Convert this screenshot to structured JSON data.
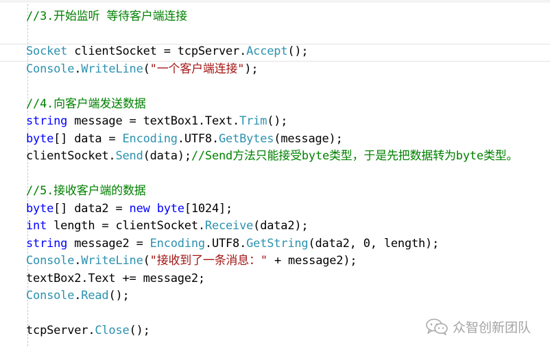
{
  "editor": {
    "language": "C#",
    "colors": {
      "comment": "#008000",
      "type": "#2b91af",
      "keyword": "#0000ff",
      "string": "#a31515",
      "plain": "#000000"
    },
    "lines": [
      {
        "tokens": [
          {
            "c": "comment",
            "t": "//3.开始监听 等待客户端连接"
          }
        ]
      },
      {
        "tokens": []
      },
      {
        "tokens": [
          {
            "c": "type",
            "t": "Socket"
          },
          {
            "c": "plain",
            "t": " clientSocket = tcpServer."
          },
          {
            "c": "type",
            "t": "Accept"
          },
          {
            "c": "plain",
            "t": "();"
          }
        ]
      },
      {
        "tokens": [
          {
            "c": "type",
            "t": "Console"
          },
          {
            "c": "plain",
            "t": "."
          },
          {
            "c": "type",
            "t": "WriteLine"
          },
          {
            "c": "plain",
            "t": "("
          },
          {
            "c": "str",
            "t": "\"一个客户端连接\""
          },
          {
            "c": "plain",
            "t": ");"
          }
        ]
      },
      {
        "tokens": []
      },
      {
        "tokens": [
          {
            "c": "comment",
            "t": "//4.向客户端发送数据"
          }
        ]
      },
      {
        "tokens": [
          {
            "c": "kw",
            "t": "string"
          },
          {
            "c": "plain",
            "t": " message = textBox1.Text."
          },
          {
            "c": "type",
            "t": "Trim"
          },
          {
            "c": "plain",
            "t": "();"
          }
        ]
      },
      {
        "tokens": [
          {
            "c": "kw",
            "t": "byte"
          },
          {
            "c": "plain",
            "t": "[] data = "
          },
          {
            "c": "type",
            "t": "Encoding"
          },
          {
            "c": "plain",
            "t": ".UTF8."
          },
          {
            "c": "type",
            "t": "GetBytes"
          },
          {
            "c": "plain",
            "t": "(message);"
          }
        ]
      },
      {
        "tokens": [
          {
            "c": "plain",
            "t": "clientSocket."
          },
          {
            "c": "type",
            "t": "Send"
          },
          {
            "c": "plain",
            "t": "(data);"
          },
          {
            "c": "comment",
            "t": "//Send方法只能接受byte类型，于是先把数据转为byte类型。"
          }
        ]
      },
      {
        "tokens": []
      },
      {
        "tokens": [
          {
            "c": "comment",
            "t": "//5.接收客户端的数据"
          }
        ]
      },
      {
        "tokens": [
          {
            "c": "kw",
            "t": "byte"
          },
          {
            "c": "plain",
            "t": "[] data2 = "
          },
          {
            "c": "kw",
            "t": "new"
          },
          {
            "c": "plain",
            "t": " "
          },
          {
            "c": "kw",
            "t": "byte"
          },
          {
            "c": "plain",
            "t": "[1024];"
          }
        ]
      },
      {
        "tokens": [
          {
            "c": "kw",
            "t": "int"
          },
          {
            "c": "plain",
            "t": " length = clientSocket."
          },
          {
            "c": "type",
            "t": "Receive"
          },
          {
            "c": "plain",
            "t": "(data2);"
          }
        ]
      },
      {
        "tokens": [
          {
            "c": "kw",
            "t": "string"
          },
          {
            "c": "plain",
            "t": " message2 = "
          },
          {
            "c": "type",
            "t": "Encoding"
          },
          {
            "c": "plain",
            "t": ".UTF8."
          },
          {
            "c": "type",
            "t": "GetString"
          },
          {
            "c": "plain",
            "t": "(data2, 0, length);"
          }
        ]
      },
      {
        "tokens": [
          {
            "c": "type",
            "t": "Console"
          },
          {
            "c": "plain",
            "t": "."
          },
          {
            "c": "type",
            "t": "WriteLine"
          },
          {
            "c": "plain",
            "t": "("
          },
          {
            "c": "str",
            "t": "\"接收到了一条消息：\""
          },
          {
            "c": "plain",
            "t": " + message2);"
          }
        ]
      },
      {
        "tokens": [
          {
            "c": "plain",
            "t": "textBox2.Text += message2;"
          }
        ]
      },
      {
        "tokens": [
          {
            "c": "type",
            "t": "Console"
          },
          {
            "c": "plain",
            "t": "."
          },
          {
            "c": "type",
            "t": "Read"
          },
          {
            "c": "plain",
            "t": "();"
          }
        ]
      },
      {
        "tokens": []
      },
      {
        "tokens": [
          {
            "c": "plain",
            "t": "tcpServer."
          },
          {
            "c": "type",
            "t": "Close"
          },
          {
            "c": "plain",
            "t": "();"
          }
        ]
      }
    ]
  },
  "watermark": {
    "text": "众智创新团队",
    "icon": "wechat-icon"
  }
}
